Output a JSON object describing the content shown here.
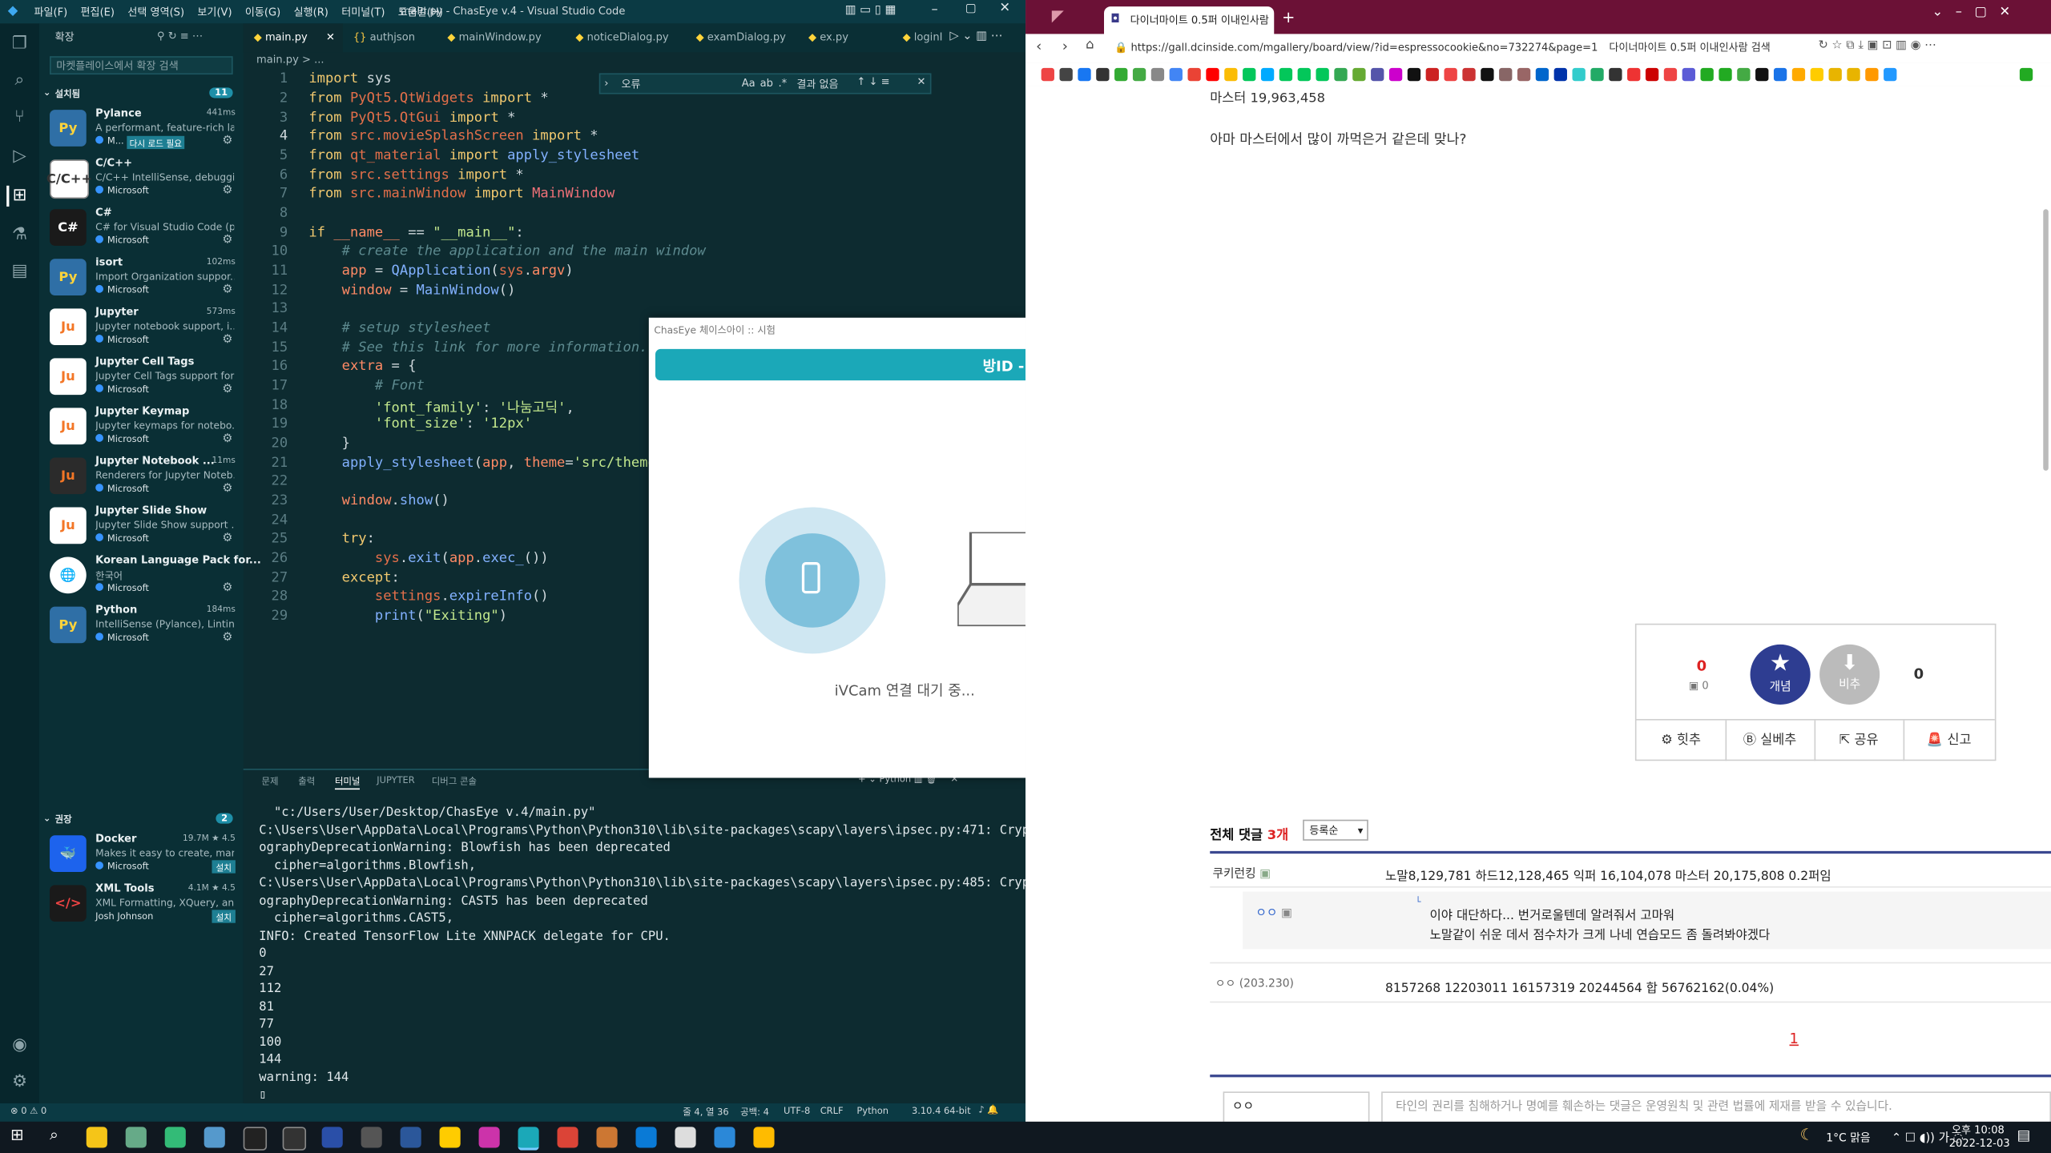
{
  "vscode": {
    "menu": [
      "파일(F)",
      "편집(E)",
      "선택 영역(S)",
      "보기(V)",
      "이동(G)",
      "실행(R)",
      "터미널(T)",
      "도움말(H)"
    ],
    "window_title": "main.py - ChasEye v.4 - Visual Studio Code",
    "extensions": {
      "header": "확장",
      "search_placeholder": "마켓플레이스에서 확장 검색",
      "installed_label": "설치됨",
      "installed_count": "11",
      "recommended_label": "권장",
      "recommended_count": "2",
      "installed": [
        {
          "name": "Pylance",
          "desc": "A performant, feature-rich la...",
          "publisher": "M...",
          "meta": "441ms",
          "badge": "다시 로드 필요"
        },
        {
          "name": "C/C++",
          "desc": "C/C++ IntelliSense, debuggi...",
          "publisher": "Microsoft",
          "meta": "",
          "badge": ""
        },
        {
          "name": "C#",
          "desc": "C# for Visual Studio Code (p...",
          "publisher": "Microsoft",
          "meta": "",
          "badge": ""
        },
        {
          "name": "isort",
          "desc": "Import Organization suppor...",
          "publisher": "Microsoft",
          "meta": "102ms",
          "badge": ""
        },
        {
          "name": "Jupyter",
          "desc": "Jupyter notebook support, i...",
          "publisher": "Microsoft",
          "meta": "573ms",
          "badge": ""
        },
        {
          "name": "Jupyter Cell Tags",
          "desc": "Jupyter Cell Tags support for...",
          "publisher": "Microsoft",
          "meta": "",
          "badge": ""
        },
        {
          "name": "Jupyter Keymap",
          "desc": "Jupyter keymaps for notebo...",
          "publisher": "Microsoft",
          "meta": "",
          "badge": ""
        },
        {
          "name": "Jupyter Notebook ...",
          "desc": "Renderers for Jupyter Noteb...",
          "publisher": "Microsoft",
          "meta": "11ms",
          "badge": ""
        },
        {
          "name": "Jupyter Slide Show",
          "desc": "Jupyter Slide Show support ...",
          "publisher": "Microsoft",
          "meta": "",
          "badge": ""
        },
        {
          "name": "Korean Language Pack for...",
          "desc": "한국어",
          "publisher": "Microsoft",
          "meta": "",
          "badge": ""
        },
        {
          "name": "Python",
          "desc": "IntelliSense (Pylance), Lintin...",
          "publisher": "Microsoft",
          "meta": "184ms",
          "badge": ""
        }
      ],
      "recommended": [
        {
          "name": "Docker",
          "desc": "Makes it easy to create, man...",
          "publisher": "Microsoft",
          "meta": "19.7M ★ 4.5",
          "button": "설치"
        },
        {
          "name": "XML Tools",
          "desc": "XML Formatting, XQuery, an...",
          "publisher": "Josh Johnson",
          "meta": "4.1M ★ 4.5",
          "button": "설치"
        }
      ]
    },
    "tabs": [
      "main.py",
      "authjson",
      "mainWindow.py",
      "noticeDialog.py",
      "examDialog.py",
      "ex.py",
      "loginI"
    ],
    "breadcrumb": "main.py > ...",
    "find": {
      "value": "오류",
      "result": "결과 없음",
      "opt1": "Aa",
      "opt2": "ab",
      "opt3": ".*"
    },
    "code_lines": [
      "1",
      "2",
      "3",
      "4",
      "5",
      "6",
      "7",
      "8",
      "9",
      "10",
      "11",
      "12",
      "13",
      "14",
      "15",
      "16",
      "17",
      "18",
      "19",
      "20",
      "21",
      "22",
      "23",
      "24",
      "25",
      "26",
      "27",
      "28",
      "29"
    ],
    "panel_tabs": [
      "문제",
      "출력",
      "터미널",
      "JUPYTER",
      "디버그 콘솔"
    ],
    "panel_python": "Python",
    "terminal": "  \"c:/Users/User/Desktop/ChasEye v.4/main.py\"\nC:\\Users\\User\\AppData\\Local\\Programs\\Python\\Python310\\lib\\site-packages\\scapy\\layers\\ipsec.py:471: Crypt\nographyDeprecationWarning: Blowfish has been deprecated\n  cipher=algorithms.Blowfish,\nC:\\Users\\User\\AppData\\Local\\Programs\\Python\\Python310\\lib\\site-packages\\scapy\\layers\\ipsec.py:485: Crypt\nographyDeprecationWarning: CAST5 has been deprecated\n  cipher=algorithms.CAST5,\nINFO: Created TensorFlow Lite XNNPACK delegate for CPU.\n0\n27\n112\n81\n77\n100\n144\nwarning: 144\n▯",
    "status": {
      "errors": "⊗ 0 ⚠ 0",
      "position": "줄 4, 열 36",
      "spaces": "공백: 4",
      "encoding": "UTF-8",
      "eol": "CRLF",
      "lang": "Python",
      "version": "3.10.4 64-bit"
    }
  },
  "chaseye": {
    "title": "ChasEye 체이스아이 :: 시험",
    "room_id": "방ID -",
    "waiting": "iVCam 연결 대기 중..."
  },
  "browser": {
    "tab_title": "다이너마이트 0.5퍼 이내인사람",
    "url": "https://gall.dcinside.com/mgallery/board/view/?id=espressocookie&no=732274&page=1",
    "url_suffix": "다이너마이트 0.5퍼 이내인사람 검색",
    "post_top_line": "마스터 19,963,458",
    "post_body": "아마 마스터에서 많이 까먹은거 같은데 맞나?",
    "vote": {
      "up_count": "0",
      "up_sub": "0",
      "up_label": "개념",
      "down_label": "비추",
      "down_count": "0"
    },
    "actions": [
      "힛추",
      "실베추",
      "공유",
      "신고"
    ],
    "comments_label": "전체 댓글",
    "comments_count": "3개",
    "sort": "등록순",
    "comments": [
      {
        "author": "쿠키런킹",
        "text": "노말8,129,781 하드12,128,465 익퍼 16,104,078 마스터 20,175,808 0.2퍼임"
      },
      {
        "author": "ㅇㅇ",
        "text": "이야 대단하다... 번거로울텐데 알려줘서 고마워",
        "text2": "노말같이 쉬운 데서 점수차가 크게 나네 연습모드 좀 돌려봐야겠다"
      },
      {
        "author": "ㅇㅇ (203.230)",
        "text": "8157268 12203011 16157319 20244564 합 56762162(0.04%)"
      }
    ],
    "page": "1",
    "reply_name": "ㅇㅇ",
    "reply_notice": "타인의 권리를 침해하거나 명예를 훼손하는 댓글은 운영원칙 및 관련 법률에 제재를 받을 수 있습니다."
  },
  "taskbar": {
    "weather": "1°C 맑음",
    "time": "오후 10:08",
    "date": "2022-12-03"
  }
}
